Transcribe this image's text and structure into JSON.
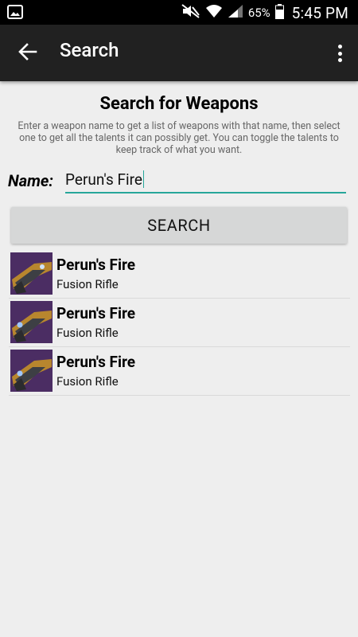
{
  "status_bar": {
    "battery_percent": "65%",
    "time": "5:45 PM",
    "icons": [
      "gallery-icon",
      "mute-icon",
      "wifi-icon",
      "signal-icon",
      "battery-icon"
    ]
  },
  "app_bar": {
    "title": "Search",
    "back_icon": "arrow-left-icon",
    "menu_icon": "overflow-menu-icon"
  },
  "main": {
    "heading": "Search for Weapons",
    "description": "Enter a weapon name to get a list of weapons with that name, then select one to get all the talents it can possibly get. You can toggle the talents to keep track of what you want.",
    "name_label": "Name:",
    "name_value": "Perun's Fire",
    "search_button": "SEARCH"
  },
  "results": [
    {
      "name": "Perun's Fire",
      "type": "Fusion Rifle"
    },
    {
      "name": "Perun's Fire",
      "type": "Fusion Rifle"
    },
    {
      "name": "Perun's Fire",
      "type": "Fusion Rifle"
    }
  ],
  "colors": {
    "accent": "#26a69a",
    "app_bar": "#212121",
    "thumb_bg": "#4b2d63"
  }
}
